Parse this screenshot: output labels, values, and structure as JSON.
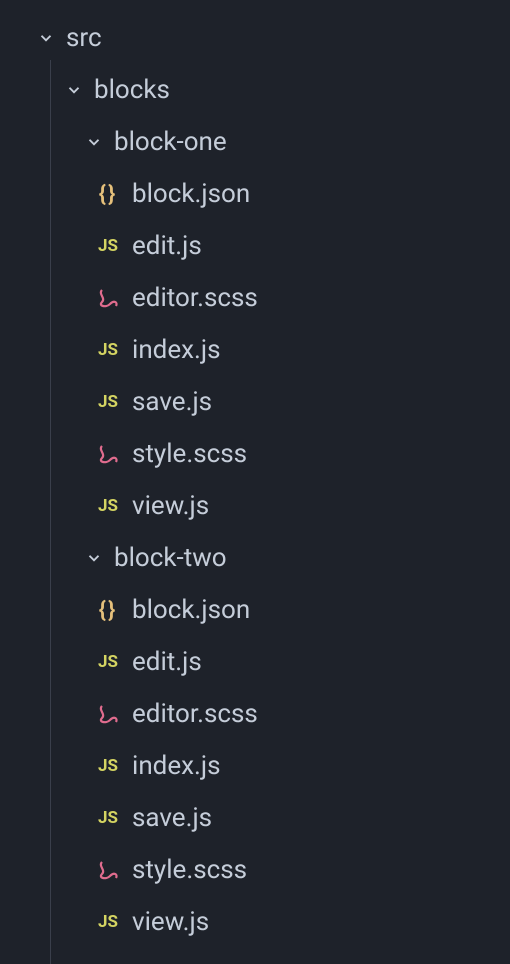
{
  "tree": {
    "src": {
      "label": "src",
      "blocks": {
        "label": "blocks",
        "block_one": {
          "label": "block-one",
          "files": {
            "block_json": "block.json",
            "edit_js": "edit.js",
            "editor_scss": "editor.scss",
            "index_js": "index.js",
            "save_js": "save.js",
            "style_scss": "style.scss",
            "view_js": "view.js"
          }
        },
        "block_two": {
          "label": "block-two",
          "files": {
            "block_json": "block.json",
            "edit_js": "edit.js",
            "editor_scss": "editor.scss",
            "index_js": "index.js",
            "save_js": "save.js",
            "style_scss": "style.scss",
            "view_js": "view.js"
          }
        }
      }
    }
  }
}
